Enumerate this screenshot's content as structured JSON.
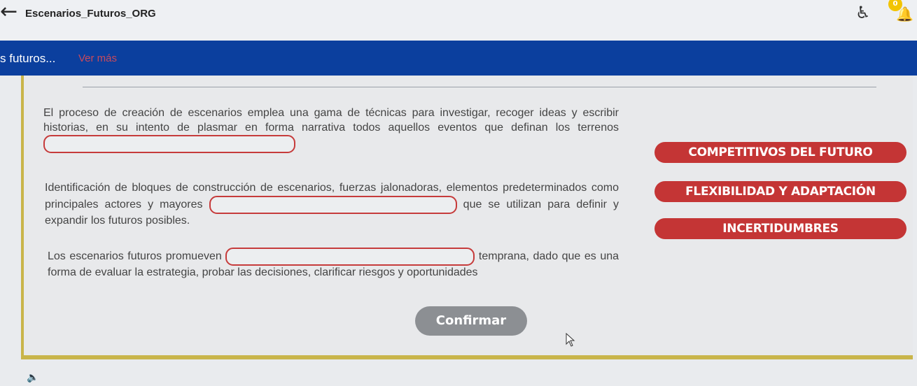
{
  "header": {
    "back_icon": "arrow-left-icon",
    "title": "Escenarios_Futuros_ORG",
    "accessibility_icon": "accessibility-icon",
    "notifications_badge": "0"
  },
  "banner": {
    "title": "s futuros...",
    "more_link": "Ver más"
  },
  "exercise": {
    "paragraph1": {
      "text_before": "El proceso de creación de escenarios emplea una gama de técnicas para investigar, recoger ideas y escribir historias, en su intento de plasmar en forma narrativa todos aquellos eventos que definan los terrenos",
      "text_after": ""
    },
    "paragraph2": {
      "text_before": "Identificación de bloques de construcción de escenarios, fuerzas jalonadoras, elementos predeterminados como principales actores y mayores",
      "text_after": "que se utilizan para definir y expandir los futuros posibles."
    },
    "paragraph3": {
      "text_before": "Los escenarios futuros promueven",
      "text_after": "temprana, dado que es una forma de evaluar la estrategia, probar las decisiones, clarificar riesgos y oportunidades"
    },
    "options": [
      "COMPETITIVOS DEL FUTURO",
      "FLEXIBILIDAD Y ADAPTACIÓN",
      "INCERTIDUMBRES"
    ],
    "confirm_label": "Confirmar"
  },
  "colors": {
    "banner": "#0b3f9e",
    "option_bg": "#c43535",
    "card_border": "#c9b54a",
    "confirm_bg": "#8c8f93"
  }
}
